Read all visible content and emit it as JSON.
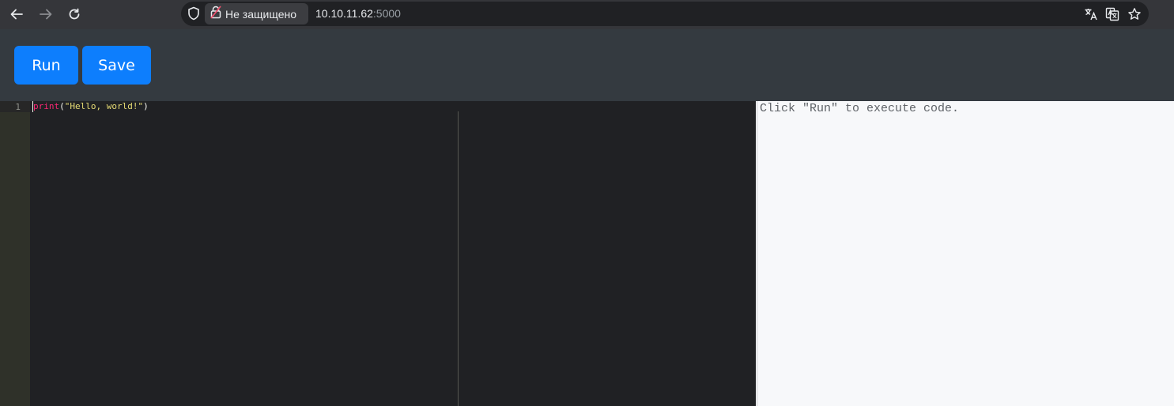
{
  "browser": {
    "security_label": "Не защищено",
    "url_host": "10.10.11.62",
    "url_port": ":5000",
    "icons": [
      "back-arrow-icon",
      "forward-arrow-icon",
      "reload-icon",
      "shield-icon",
      "lock-icon",
      "translate-icon",
      "google-translate-icon",
      "bookmark-star-icon"
    ]
  },
  "toolbar": {
    "run_label": "Run",
    "save_label": "Save",
    "button_color": "#0d7efd"
  },
  "editor": {
    "line_numbers": [
      "1"
    ],
    "code": {
      "fn": "print",
      "open": "(",
      "string": "\"Hello, world!\"",
      "close": ")"
    },
    "colors": {
      "function": "#f92672",
      "string": "#e6db74",
      "background": "#202124"
    }
  },
  "output": {
    "placeholder": "Click \"Run\" to execute code."
  }
}
